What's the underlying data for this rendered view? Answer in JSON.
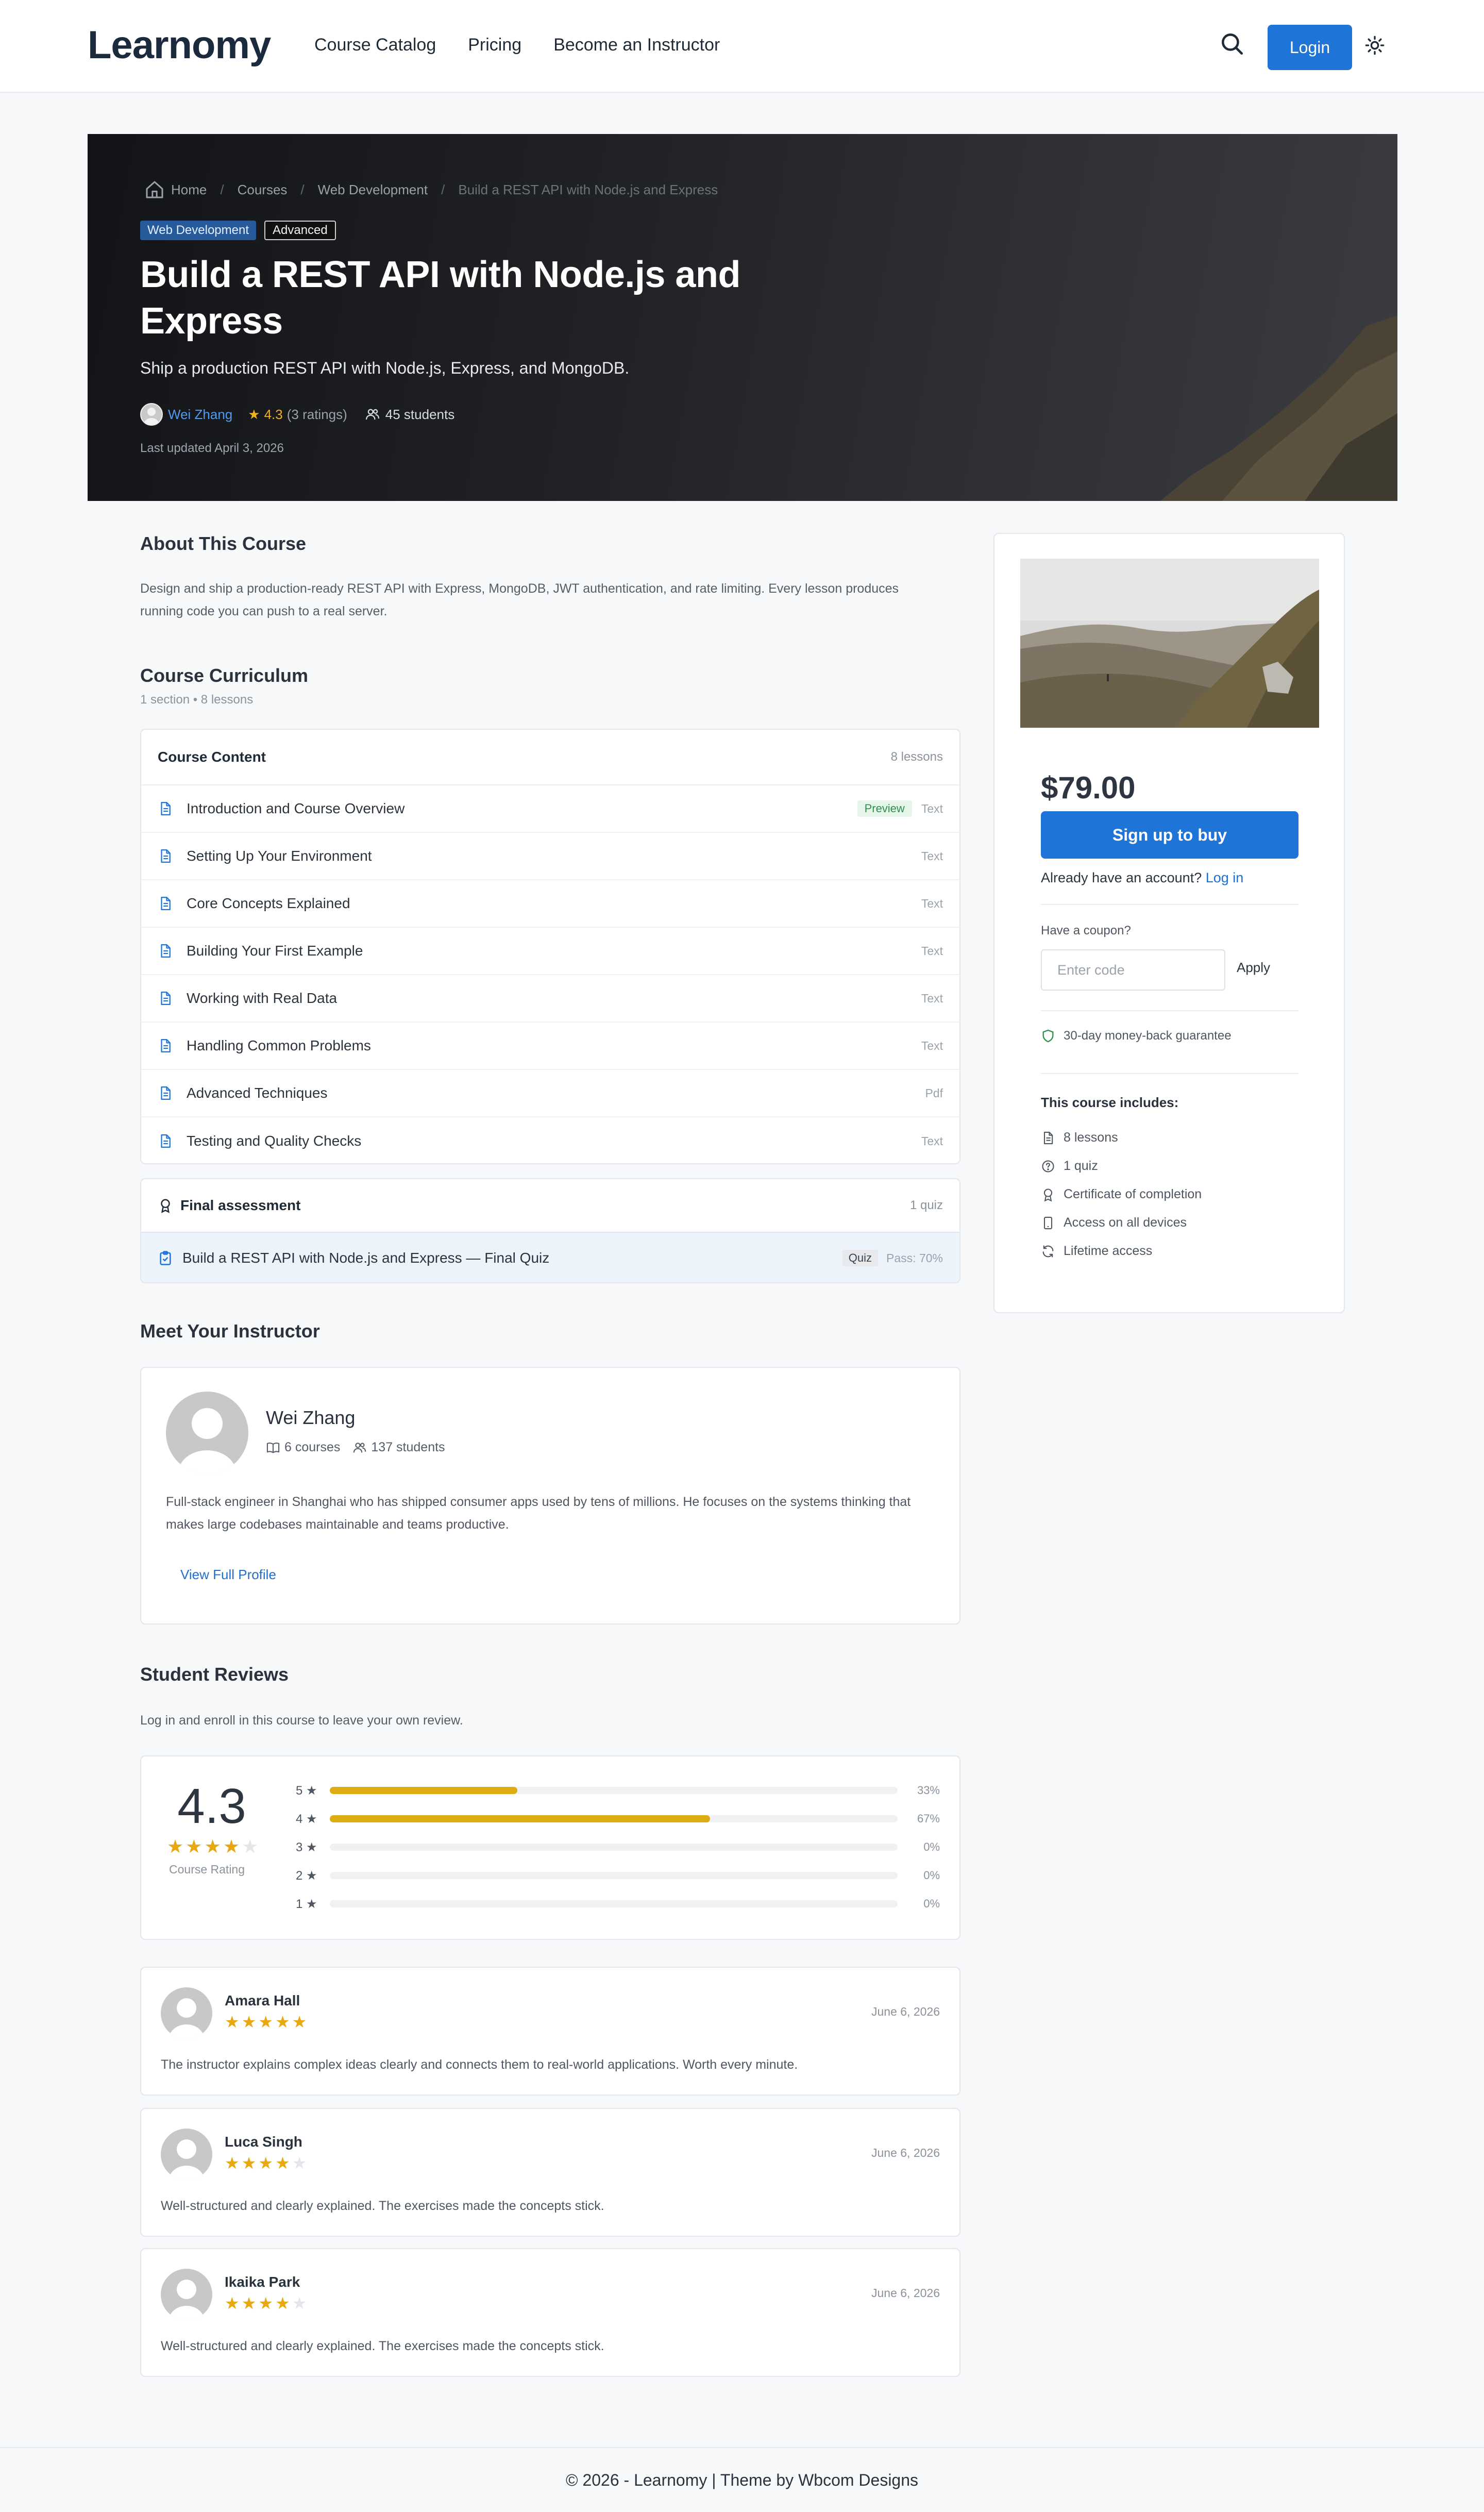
{
  "header": {
    "logo": "Learnomy",
    "nav": [
      "Course Catalog",
      "Pricing",
      "Become an Instructor"
    ],
    "login": "Login"
  },
  "hero": {
    "breadcrumb": [
      "Home",
      "Courses",
      "Web Development",
      "Build a REST API with Node.js and Express"
    ],
    "badge_category": "Web Development",
    "badge_level": "Advanced",
    "title": "Build a REST API with Node.js and Express",
    "subtitle": "Ship a production REST API with Node.js, Express, and MongoDB.",
    "author": "Wei Zhang",
    "rating": "4.3",
    "ratings_count": "(3 ratings)",
    "students": "45 students",
    "updated": "Last updated April 3, 2026"
  },
  "about": {
    "title": "About This Course",
    "text": "Design and ship a production-ready REST API with Express, MongoDB, JWT authentication, and rate limiting. Every lesson produces running code you can push to a real server."
  },
  "curriculum": {
    "title": "Course Curriculum",
    "meta": "1 section • 8 lessons",
    "content_title": "Course Content",
    "content_count": "8 lessons",
    "lessons": [
      {
        "name": "Introduction and Course Overview",
        "preview": "Preview",
        "type": "Text"
      },
      {
        "name": "Setting Up Your Environment",
        "preview": "",
        "type": "Text"
      },
      {
        "name": "Core Concepts Explained",
        "preview": "",
        "type": "Text"
      },
      {
        "name": "Building Your First Example",
        "preview": "",
        "type": "Text"
      },
      {
        "name": "Working with Real Data",
        "preview": "",
        "type": "Text"
      },
      {
        "name": "Handling Common Problems",
        "preview": "",
        "type": "Text"
      },
      {
        "name": "Advanced Techniques",
        "preview": "",
        "type": "Pdf"
      },
      {
        "name": "Testing and Quality Checks",
        "preview": "",
        "type": "Text"
      }
    ],
    "assessment_title": "Final assessment",
    "assessment_count": "1 quiz",
    "quiz_name": "Build a REST API with Node.js and Express — Final Quiz",
    "quiz_badge": "Quiz",
    "quiz_pass": "Pass: 70%"
  },
  "instructor": {
    "title": "Meet Your Instructor",
    "name": "Wei Zhang",
    "courses": "6 courses",
    "students": "137 students",
    "bio": "Full-stack engineer in Shanghai who has shipped consumer apps used by tens of millions. He focuses on the systems thinking that makes large codebases maintainable and teams productive.",
    "link": "View Full Profile"
  },
  "reviews": {
    "title": "Student Reviews",
    "note": "Log in and enroll in this course to leave your own review.",
    "average": "4.3",
    "average_stars": 4.3,
    "average_label": "Course Rating",
    "distribution": [
      {
        "label": "5 ★",
        "fraction": 0.33,
        "pct": "33%"
      },
      {
        "label": "4 ★",
        "fraction": 0.67,
        "pct": "67%"
      },
      {
        "label": "3 ★",
        "fraction": 0,
        "pct": "0%"
      },
      {
        "label": "2 ★",
        "fraction": 0,
        "pct": "0%"
      },
      {
        "label": "1 ★",
        "fraction": 0,
        "pct": "0%"
      }
    ],
    "items": [
      {
        "name": "Amara Hall",
        "stars": 5,
        "date": "June 6, 2026",
        "text": "The instructor explains complex ideas clearly and connects them to real-world applications. Worth every minute."
      },
      {
        "name": "Luca Singh",
        "stars": 4,
        "date": "June 6, 2026",
        "text": "Well-structured and clearly explained. The exercises made the concepts stick."
      },
      {
        "name": "Ikaika Park",
        "stars": 4,
        "date": "June 6, 2026",
        "text": "Well-structured and clearly explained. The exercises made the concepts stick."
      }
    ]
  },
  "sidebar": {
    "price": "$79.00",
    "buy": "Sign up to buy",
    "already_text": "Already have an account?",
    "already_link": "Log in",
    "coupon_label": "Have a coupon?",
    "coupon_placeholder": "Enter code",
    "coupon_apply": "Apply",
    "guarantee": "30-day money-back guarantee",
    "includes_title": "This course includes:",
    "includes": [
      {
        "icon": "document-icon",
        "text": "8 lessons"
      },
      {
        "icon": "question-icon",
        "text": "1 quiz"
      },
      {
        "icon": "award-icon",
        "text": "Certificate of completion"
      },
      {
        "icon": "device-icon",
        "text": "Access on all devices"
      },
      {
        "icon": "refresh-icon",
        "text": "Lifetime access"
      }
    ]
  },
  "footer": {
    "text": "© 2026 - Learnomy | Theme by Wbcom Designs"
  },
  "colors": {
    "accent": "#1f74d8",
    "star": "#e8a811",
    "preview_green": "#2f8f4c",
    "hero_bg": "#1c1e22"
  }
}
